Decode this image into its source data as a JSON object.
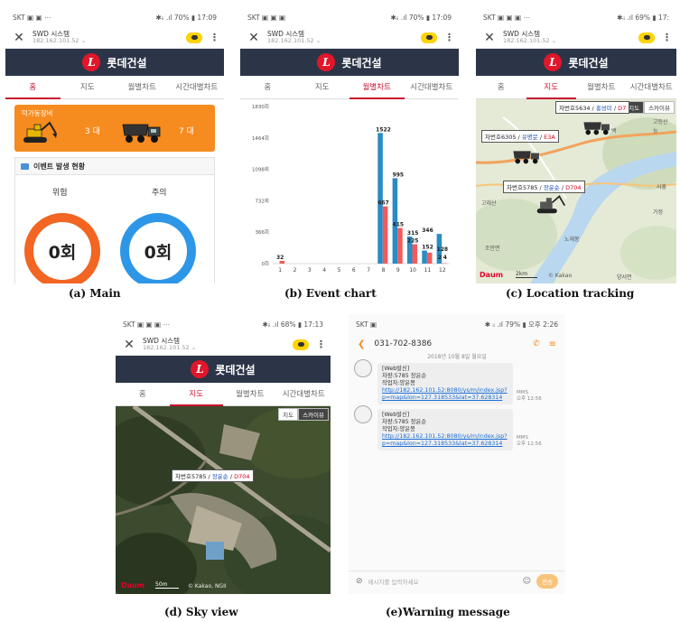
{
  "main": {
    "status": {
      "left": "SKT ▣ ▣ ⋯",
      "right": "✱ᵢᵢ .ıl 70% ▮ 17:09"
    },
    "browser": {
      "title": "SWD 시스템",
      "url": "182.162.101.52 ⌄"
    },
    "app_title": "롯데건설",
    "tabs": [
      "홈",
      "지도",
      "월별차트",
      "시간대별차트"
    ],
    "equip_label": "덕가동장비",
    "excavator_count": "3 대",
    "truck_count": "7 대",
    "event_title": "이벤트 발생 현황",
    "danger_label": "위험",
    "caution_label": "주의",
    "danger_value": "0회",
    "caution_value": "0회",
    "caption": "(a) Main"
  },
  "chart": {
    "status": {
      "left": "SKT ▣ ▣ ▣",
      "right": "✱ᵢᵢ .ıl 70% ▮ 17:09"
    },
    "browser": {
      "title": "SWD 시스템",
      "url": "182.162.101.52 ⌄"
    },
    "app_title": "롯데건설",
    "tabs": [
      "홈",
      "지도",
      "월별차트",
      "시간대별차트"
    ],
    "caption": "(b) Event chart"
  },
  "chart_data": {
    "type": "bar",
    "categories": [
      "1",
      "2",
      "3",
      "4",
      "5",
      "6",
      "7",
      "8",
      "9",
      "10",
      "11",
      "12"
    ],
    "y_ticks": [
      "0회",
      "366회",
      "732회",
      "1098회",
      "1464회",
      "1830회"
    ],
    "ylim": [
      0,
      1830
    ],
    "series": [
      {
        "values": [
          0,
          0,
          0,
          0,
          0,
          0,
          0,
          1522,
          995,
          315,
          152,
          346
        ]
      },
      {
        "values": [
          32,
          0,
          0,
          0,
          0,
          0,
          0,
          667,
          415,
          225,
          128,
          4
        ]
      }
    ],
    "data_labels": [
      {
        "text": "32",
        "cat": 0,
        "value": 32
      },
      {
        "text": "1522",
        "cat": 7,
        "value": 1522
      },
      {
        "text": "667",
        "cat": 7,
        "value": 667
      },
      {
        "text": "995",
        "cat": 8,
        "value": 995
      },
      {
        "text": "415",
        "cat": 8,
        "value": 415
      },
      {
        "text": "315",
        "cat": 9,
        "value": 315
      },
      {
        "text": "225",
        "cat": 9,
        "value": 225
      },
      {
        "text": "152",
        "cat": 10,
        "value": 152
      },
      {
        "text": "346",
        "cat": 10,
        "value": 346
      },
      {
        "text": "128",
        "cat": 11,
        "value": 128
      },
      {
        "text": "2",
        "cat": 11,
        "value": 30
      },
      {
        "text": "4",
        "cat": 11,
        "value": 30
      }
    ],
    "colors": [
      "#2a8bc6",
      "#f25b5b"
    ],
    "grid": false
  },
  "location": {
    "status": {
      "left": "SKT ▣ ▣ ▣ ⋯",
      "right": "✱ᵢᵢ .ıl 69% ▮ 17:"
    },
    "browser": {
      "title": "SWD 시스템",
      "url": "182.162.101.52 ⌄"
    },
    "app_title": "롯데건설",
    "tabs": [
      "홈",
      "지도",
      "월별차트",
      "시간대별차트"
    ],
    "map_buttons": [
      "지도",
      "스카이뷰"
    ],
    "labels": [
      {
        "prefix": "차번호5634 / ",
        "name": "홍성미",
        "sep": " / ",
        "code": "D7"
      },
      {
        "prefix": "차번호6305 / ",
        "name": "유명문",
        "sep": " / ",
        "code": "E3A"
      },
      {
        "prefix": "차번호5785 / ",
        "name": "장윤순",
        "sep": " / ",
        "code": "D704"
      }
    ],
    "places": [
      "고등산",
      "고래산",
      "노재봉",
      "사흥",
      "조안면",
      "양서면",
      "백",
      "능",
      "가정"
    ],
    "map_logo": "Daum",
    "copyright": "© Kakao",
    "scale": "2km",
    "caption": "(c) Location tracking"
  },
  "sky": {
    "status": {
      "left": "SKT ▣ ▣ ▣ ⋯",
      "right": "✱ᵢᵢ .ıl 68% ▮ 17:13"
    },
    "browser": {
      "title": "SWD 시스템",
      "url": "182.162.101.52 ⌄"
    },
    "app_title": "롯데건설",
    "tabs": [
      "홈",
      "지도",
      "월별차트",
      "시간대별차트"
    ],
    "map_buttons": [
      "지도",
      "스카이뷰"
    ],
    "label": {
      "prefix": "차번호5785 / ",
      "name": "장윤순",
      "sep": " / ",
      "code": "D704"
    },
    "map_logo": "Daum",
    "scale": "50m",
    "copyright": "© Kakao, NGII",
    "caption": "(d) Sky view"
  },
  "sms": {
    "status": {
      "left": "SKT ▣",
      "right": "✱ ᵢᵢ .ıl 79% ▮ 오후 2:26"
    },
    "phone": "031-702-8386",
    "date": "2018년 10월 8일 월요일",
    "messages": [
      {
        "line1": "[Web발신]",
        "line2": "차량:5785 장윤순",
        "line3": "작업자:양윤봉",
        "link": "http://182.162.101.52:8080/ys/m/index.jsp?p=map&lon=127.318533&lat=37.628314",
        "type": "MMS",
        "time": "오후 12:56"
      },
      {
        "line1": "[Web발신]",
        "line2": "차량:5785 장윤순",
        "line3": "작업자:양윤봉",
        "link": "http://182.162.101.52:8080/ys/m/index.jsp?p=map&lon=127.318533&lat=37.628314",
        "type": "MMS",
        "time": "오후 12:56"
      }
    ],
    "input_placeholder": "메시지를 입력하세요",
    "send_label": "전송",
    "caption": "(e)Warning message"
  },
  "colors": {
    "accent": "#c8102e",
    "appbar": "#2c3548",
    "orange": "#f68b1f",
    "danger": "#f26522",
    "caution": "#2e96e6"
  }
}
